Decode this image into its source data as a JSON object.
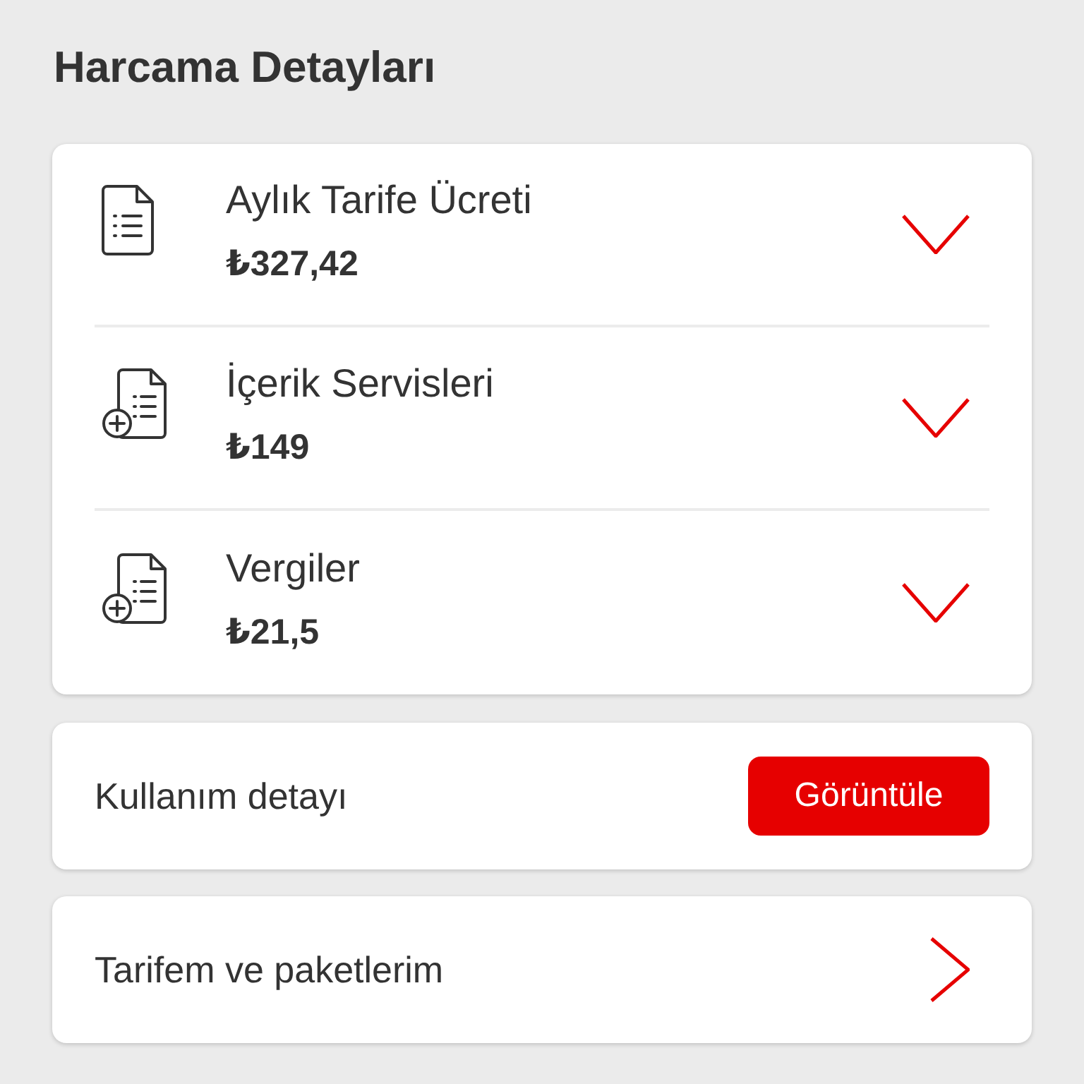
{
  "page": {
    "title": "Harcama Detayları"
  },
  "expenses": [
    {
      "kind": "document",
      "label": "Aylık Tarife Ücreti",
      "amount": "₺327,42",
      "expanded": false
    },
    {
      "kind": "document-add",
      "label": "İçerik Servisleri",
      "amount": "₺149",
      "expanded": false
    },
    {
      "kind": "document-add",
      "label": "Vergiler",
      "amount": "₺21,5",
      "expanded": false
    }
  ],
  "usage": {
    "label": "Kullanım detayı",
    "button": "Görüntüle"
  },
  "link": {
    "label": "Tarifem ve paketlerim"
  }
}
